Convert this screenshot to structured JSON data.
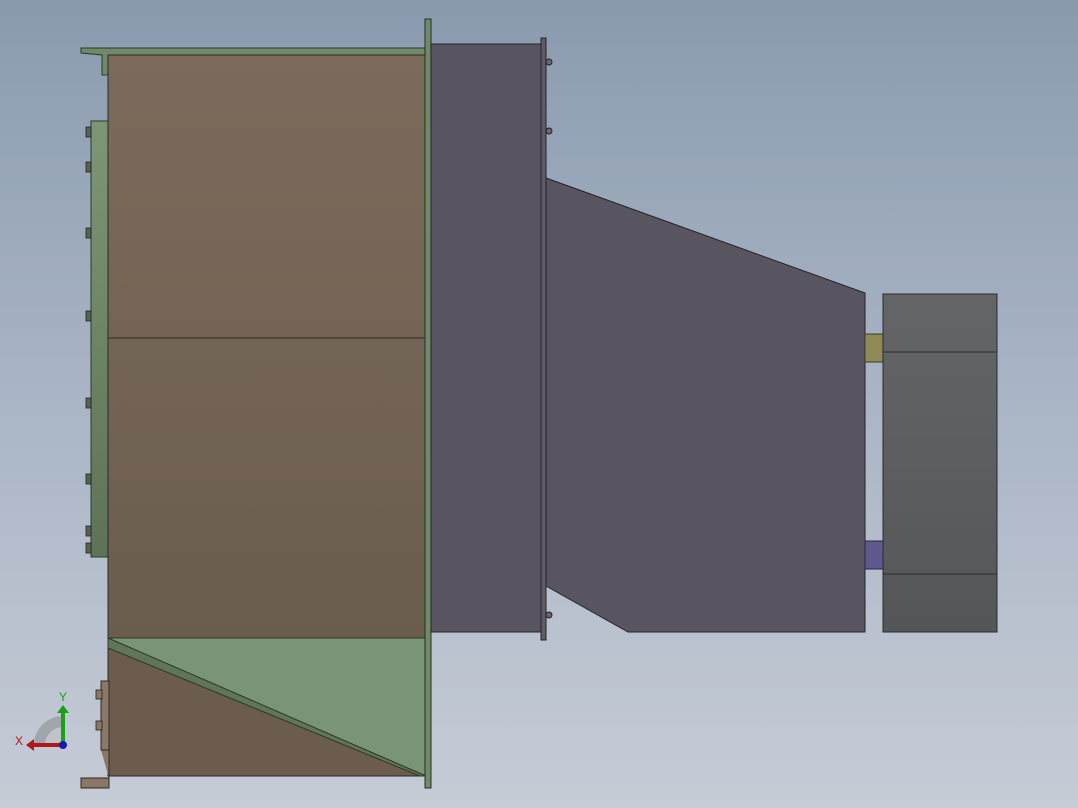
{
  "viewport": {
    "background_top": "#8a9aae",
    "background_bottom": "#c6ccd6"
  },
  "model": {
    "colors": {
      "housing_brown": "#76695b",
      "flange_green": "#6f8a68",
      "hopper_green": "#7a9478",
      "duct_purple": "#585460",
      "motor_gray": "#5d5f61",
      "coupling_olive": "#8f8a55",
      "coupling_blue": "#5e5a8e"
    }
  },
  "triad": {
    "x_label": "X",
    "y_label": "Y",
    "x_color": "#b01818",
    "y_color": "#18a018",
    "z_color": "#1818b0",
    "icon": "coordinate-triad-icon"
  }
}
